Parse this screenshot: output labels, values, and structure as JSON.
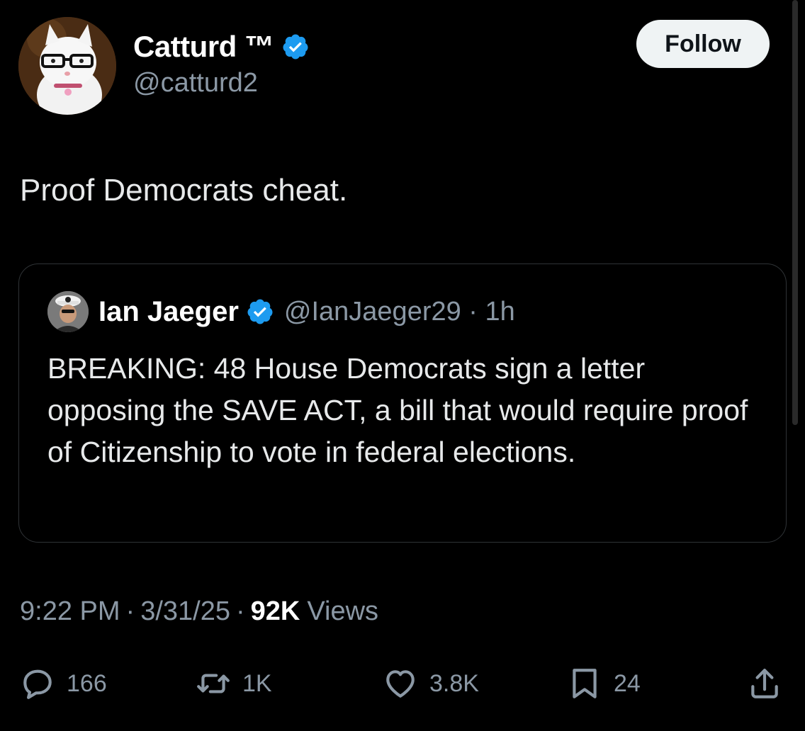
{
  "author": {
    "display_name": "Catturd ™",
    "handle": "@catturd2",
    "avatar": "cat-with-glasses-avatar",
    "verified_icon": "verified-badge-icon"
  },
  "follow_label": "Follow",
  "tweet_text": "Proof Democrats cheat.",
  "quote": {
    "display_name": "Ian Jaeger",
    "handle_time": "@IanJaeger29 · 1h",
    "body": "BREAKING: 48 House Democrats sign a letter opposing the SAVE ACT, a bill that would require proof of Citizenship to vote in federal elections."
  },
  "meta": {
    "time": "9:22 PM",
    "date": "3/31/25",
    "views_count": "92K",
    "views_label": "Views",
    "separator": "·"
  },
  "actions": {
    "replies": "166",
    "reposts": "1K",
    "likes": "3.8K",
    "bookmarks": "24"
  },
  "colors": {
    "background": "#000000",
    "text": "#e7e9ea",
    "secondary": "#8b98a5",
    "verified": "#1d9bf0",
    "border": "#2f3336",
    "follow_bg": "#eff3f4"
  }
}
